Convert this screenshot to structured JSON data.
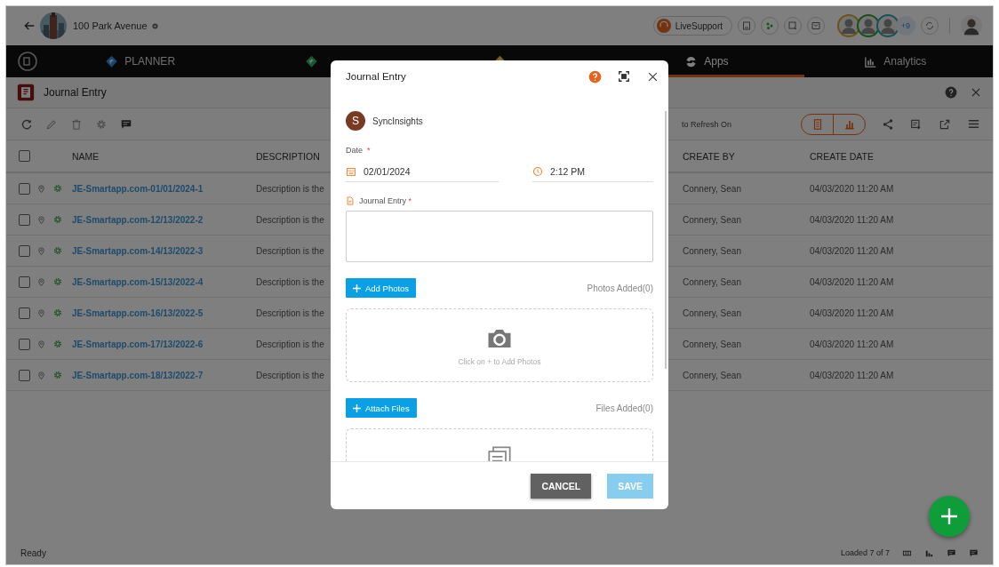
{
  "header": {
    "project": "100 Park Avenue",
    "live_support": "LiveSupport",
    "collaborators": [
      {
        "kind": "person"
      },
      {
        "kind": "person"
      },
      {
        "kind": "person"
      }
    ],
    "more_count": "+9"
  },
  "nav": {
    "tabs": [
      {
        "label": "PLANNER",
        "kind": "planner",
        "selected": false
      },
      {
        "kind": "field",
        "selected": false
      },
      {
        "kind": "safety"
      },
      {
        "label": "Apps",
        "kind": "swirl",
        "selected": true
      },
      {
        "label": "Analytics",
        "kind": "chart",
        "selected": false
      }
    ]
  },
  "app": {
    "title": "Journal Entry",
    "auto_refresh": "to Refresh On"
  },
  "table": {
    "all_checked": false,
    "columns": [
      "NAME",
      "DESCRIPTION",
      "CREATE BY",
      "CREATE DATE"
    ],
    "rows": [
      {
        "name": "JE-Smartapp.com-01/01/2024-1",
        "description": "Description is the",
        "create_by": "Connery, Sean",
        "create_date": "04/03/2020 11:20 AM",
        "checked": false
      },
      {
        "name": "JE-Smartapp.com-12/13/2022-2",
        "description": "Description is the",
        "create_by": "Connery, Sean",
        "create_date": "04/03/2020 11:20 AM",
        "checked": false
      },
      {
        "name": "JE-Smartapp.com-14/13/2022-3",
        "description": "Description is the",
        "create_by": "Connery, Sean",
        "create_date": "04/03/2020 11:20 AM",
        "checked": false
      },
      {
        "name": "JE-Smartapp.com-15/13/2022-4",
        "description": "Description is the",
        "create_by": "Connery, Sean",
        "create_date": "04/03/2020 11:20 AM",
        "checked": false
      },
      {
        "name": "JE-Smartapp.com-16/13/2022-5",
        "description": "Description is the",
        "create_by": "Connery, Sean",
        "create_date": "04/03/2020 11:20 AM",
        "checked": false
      },
      {
        "name": "JE-Smartapp.com-17/13/2022-6",
        "description": "Description is the",
        "create_by": "Connery, Sean",
        "create_date": "04/03/2020 11:20 AM",
        "checked": false
      },
      {
        "name": "JE-Smartapp.com-18/13/2022-7",
        "description": "Description is the",
        "create_by": "Connery, Sean",
        "create_date": "04/03/2020 11:20 AM",
        "checked": false
      }
    ]
  },
  "status_bar": {
    "text": "Ready",
    "loaded": "Loaded 7 of 7"
  },
  "dialog": {
    "title": "Journal Entry",
    "author": {
      "initial": "S",
      "name": "SyncInsights"
    },
    "date_label": "Date",
    "date_mark": "*",
    "date": "02/01/2024",
    "time": "2:12 PM",
    "entry_label": "Journal Entry",
    "entry_mark": "*",
    "photos_button": "Add Photos",
    "photos_count": "Photos Added(0)",
    "photos_hint": "Click on + to Add Photos",
    "files_button": "Attach Files",
    "files_count": "Files Added(0)",
    "cancel": "CANCEL",
    "save": {
      "label": "SAVE",
      "disabled": true
    }
  }
}
